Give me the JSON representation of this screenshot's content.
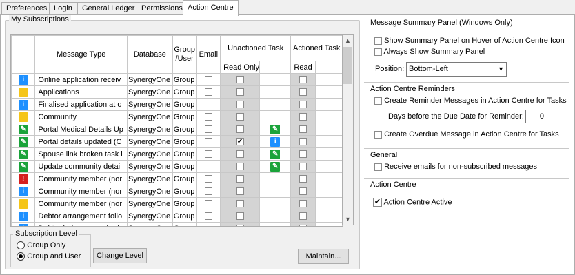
{
  "tabs": [
    "Preferences",
    "Login",
    "General Ledger",
    "Permissions",
    "Action Centre"
  ],
  "subscriptions": {
    "title": "My Subscriptions",
    "headers": {
      "message_type": "Message Type",
      "database": "Database",
      "group_user": "Group /User",
      "email": "Email",
      "unactioned": "Unactioned Task",
      "actioned": "Actioned Task",
      "read_only": "Read Only",
      "read": "Read"
    },
    "rows": [
      {
        "icon": "info-icon",
        "type": "Online application receiv",
        "db": "SynergyOne",
        "gu": "Group",
        "email": false,
        "ro": false,
        "unact_icon": "",
        "read": false
      },
      {
        "icon": "folder-icon",
        "type": "Applications",
        "db": "SynergyOne",
        "gu": "Group",
        "email": false,
        "ro": false,
        "unact_icon": "",
        "read": false
      },
      {
        "icon": "info-icon",
        "type": "Finalised application at o",
        "db": "SynergyOne",
        "gu": "Group",
        "email": false,
        "ro": false,
        "unact_icon": "",
        "read": false
      },
      {
        "icon": "folder-icon",
        "type": "Community",
        "db": "SynergyOne",
        "gu": "Group",
        "email": false,
        "ro": false,
        "unact_icon": "",
        "read": false
      },
      {
        "icon": "pencil-icon",
        "type": "Portal Medical Details Up",
        "db": "SynergyOne",
        "gu": "Group",
        "email": false,
        "ro": false,
        "unact_icon": "pencil-icon",
        "read": false
      },
      {
        "icon": "pencil-icon",
        "type": "Portal details updated (C",
        "db": "SynergyOne",
        "gu": "Group",
        "email": false,
        "ro": true,
        "unact_icon": "info-icon",
        "read": false
      },
      {
        "icon": "pencil-icon",
        "type": "Spouse link broken task i",
        "db": "SynergyOne",
        "gu": "Group",
        "email": false,
        "ro": false,
        "unact_icon": "pencil-icon",
        "read": false
      },
      {
        "icon": "pencil-icon",
        "type": "Update community detai",
        "db": "SynergyOne",
        "gu": "Group",
        "email": false,
        "ro": false,
        "unact_icon": "pencil-icon",
        "read": false
      },
      {
        "icon": "alert-icon",
        "type": "Community member (nor",
        "db": "SynergyOne",
        "gu": "Group",
        "email": false,
        "ro": false,
        "unact_icon": "",
        "read": false
      },
      {
        "icon": "info-icon",
        "type": "Community member (nor",
        "db": "SynergyOne",
        "gu": "Group",
        "email": false,
        "ro": false,
        "unact_icon": "",
        "read": false
      },
      {
        "icon": "folder-icon",
        "type": "Community member (nor",
        "db": "SynergyOne",
        "gu": "Group",
        "email": false,
        "ro": false,
        "unact_icon": "",
        "read": false
      },
      {
        "icon": "info-icon",
        "type": "Debtor arrangement follo",
        "db": "SynergyOne",
        "gu": "Group",
        "email": false,
        "ro": false,
        "unact_icon": "",
        "read": false
      },
      {
        "icon": "info-icon",
        "type": "Debtor balance reached",
        "db": "SynergyOne",
        "gu": "Group",
        "email": false,
        "ro": false,
        "unact_icon": "",
        "read": false
      }
    ],
    "level_title": "Subscription Level",
    "level_options": [
      "Group Only",
      "Group and User"
    ],
    "level_selected": 1,
    "change_level_label": "Change Level",
    "maintain_label": "Maintain..."
  },
  "summary_panel": {
    "title": "Message Summary Panel (Windows Only)",
    "show_on_hover": "Show Summary Panel on Hover of Action Centre Icon",
    "always_show": "Always Show Summary Panel",
    "position_label": "Position:",
    "position_value": "Bottom-Left"
  },
  "reminders": {
    "title": "Action Centre Reminders",
    "create_reminder": "Create Reminder Messages in Action Centre for Tasks",
    "days_label": "Days before the Due Date for Reminder:",
    "days_value": "0",
    "create_overdue": "Create Overdue Message in Action Centre for Tasks"
  },
  "general": {
    "title": "General",
    "receive_emails": "Receive emails for non-subscribed messages"
  },
  "action_centre": {
    "title": "Action Centre",
    "active_label": "Action Centre Active",
    "active": true
  }
}
